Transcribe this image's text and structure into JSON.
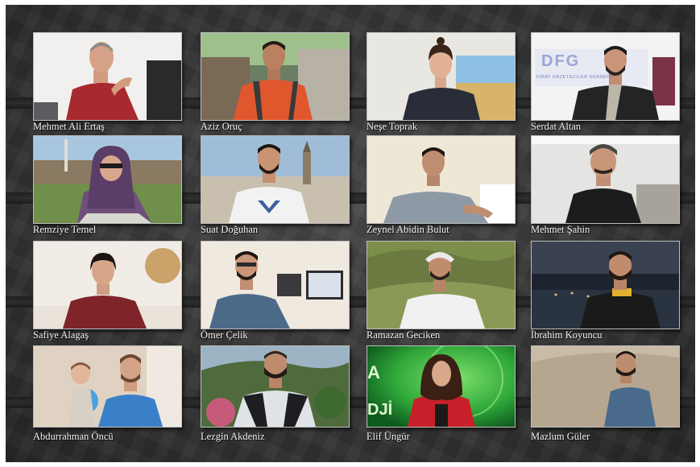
{
  "journalists": [
    {
      "name": "Mehmet Ali Ertaş"
    },
    {
      "name": "Aziz Oruç"
    },
    {
      "name": "Neşe Toprak"
    },
    {
      "name": "Serdat Altan"
    },
    {
      "name": "Remziye Temel"
    },
    {
      "name": "Suat Doğuhan"
    },
    {
      "name": "Zeynel Abidin Bulut"
    },
    {
      "name": "Mehmet Şahin"
    },
    {
      "name": "Safiye Alagaş"
    },
    {
      "name": "Ömer Çelik"
    },
    {
      "name": "Ramazan Geciken"
    },
    {
      "name": "İbrahim Koyuncu"
    },
    {
      "name": "Abdurrahman Öncü"
    },
    {
      "name": "Lezgin Akdeniz"
    },
    {
      "name": "Elif Üngür"
    },
    {
      "name": "Mazlum Güler"
    }
  ],
  "backdrop_text": {
    "dfg_logo": "DFG",
    "dfg_subtitle": "FIRAT GAZETECİLER DERNEĞİ",
    "green_screen_left": "A",
    "green_screen_bottom": "DJİ"
  },
  "colors": {
    "background": "#3a3a3a",
    "name_text": "#f4f4f4",
    "photo_border": "#bdbdbd"
  }
}
